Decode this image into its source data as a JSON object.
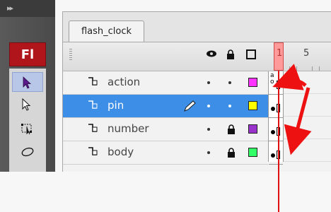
{
  "toolbar": {
    "logo": "Fl",
    "tools": [
      {
        "icon": "selection-arrow-icon",
        "selected": true
      },
      {
        "icon": "subselection-arrow-icon",
        "selected": false
      },
      {
        "icon": "free-transform-icon",
        "selected": false
      },
      {
        "icon": "lasso-icon",
        "selected": false
      }
    ]
  },
  "document_tab": {
    "label": "flash_clock"
  },
  "timeline": {
    "header_icons": [
      "eye-icon",
      "lock-icon",
      "outline-square-icon"
    ],
    "frame_numbers": [
      "1",
      "5"
    ],
    "current_frame": 1,
    "layers": [
      {
        "name": "action",
        "color": "#ff33ff",
        "locked": false,
        "selected": false,
        "editing": false,
        "frame_label": "a\no"
      },
      {
        "name": "pin",
        "color": "#ffff00",
        "locked": false,
        "selected": true,
        "editing": true
      },
      {
        "name": "number",
        "color": "#9933cc",
        "locked": true,
        "selected": false,
        "editing": false
      },
      {
        "name": "body",
        "color": "#33ff66",
        "locked": true,
        "selected": false,
        "editing": false
      }
    ]
  },
  "annotation": {
    "arrow_color": "#ee1111"
  }
}
